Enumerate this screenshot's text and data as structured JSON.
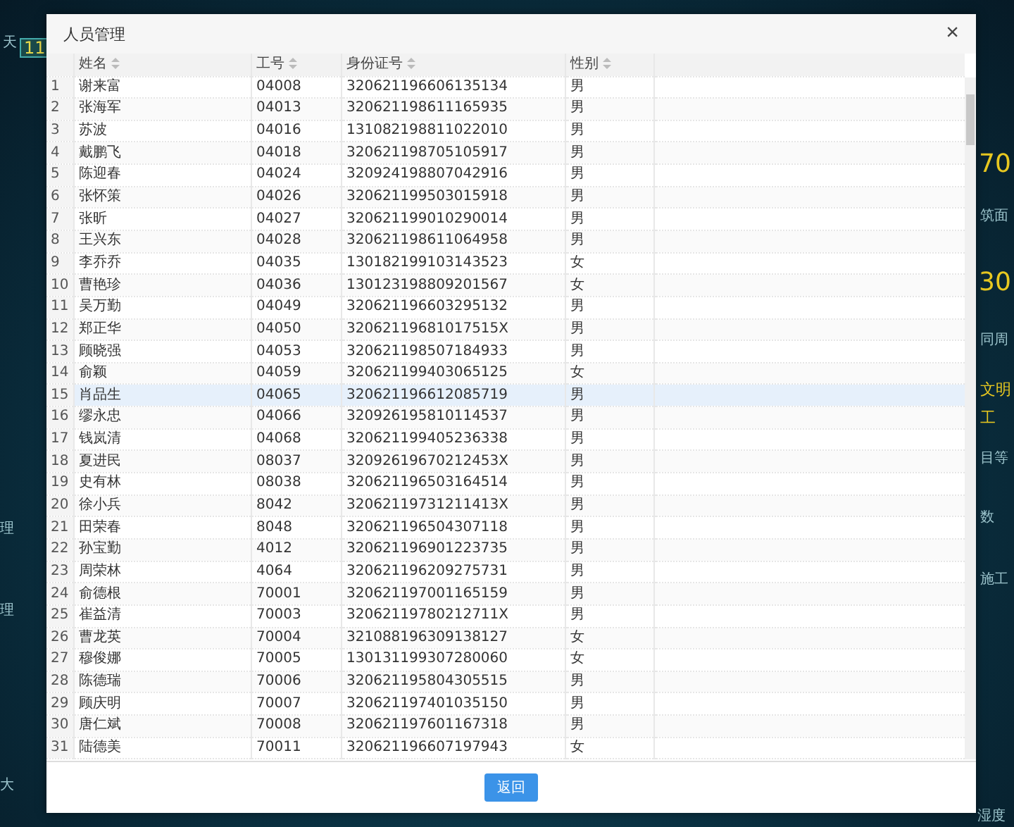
{
  "background": {
    "left_texts": [
      "天",
      "11",
      "理",
      "理",
      "大"
    ],
    "right_texts": [
      "70",
      "筑面",
      "30",
      "同周",
      "文明",
      "工",
      "目等",
      "数",
      "施工",
      "湿度"
    ]
  },
  "dialog": {
    "title": "人员管理",
    "close": "×",
    "table": {
      "columns": [
        {
          "label": "姓名",
          "sortable": true
        },
        {
          "label": "工号",
          "sortable": true
        },
        {
          "label": "身份证号",
          "sortable": true
        },
        {
          "label": "性别",
          "sortable": true
        }
      ],
      "rows": [
        {
          "index": "1",
          "cells": [
            "谢来富",
            "04008",
            "320621196606135134",
            "男"
          ],
          "selected": false
        },
        {
          "index": "2",
          "cells": [
            "张海军",
            "04013",
            "320621198611165935",
            "男"
          ],
          "selected": false
        },
        {
          "index": "3",
          "cells": [
            "苏波",
            "04016",
            "131082198811022010",
            "男"
          ],
          "selected": false
        },
        {
          "index": "4",
          "cells": [
            "戴鹏飞",
            "04018",
            "320621198705105917",
            "男"
          ],
          "selected": false
        },
        {
          "index": "5",
          "cells": [
            "陈迎春",
            "04024",
            "320924198807042916",
            "男"
          ],
          "selected": false
        },
        {
          "index": "6",
          "cells": [
            "张怀策",
            "04026",
            "320621199503015918",
            "男"
          ],
          "selected": false
        },
        {
          "index": "7",
          "cells": [
            "张昕",
            "04027",
            "320621199010290014",
            "男"
          ],
          "selected": false
        },
        {
          "index": "8",
          "cells": [
            "王兴东",
            "04028",
            "320621198611064958",
            "男"
          ],
          "selected": false
        },
        {
          "index": "9",
          "cells": [
            "李乔乔",
            "04035",
            "130182199103143523",
            "女"
          ],
          "selected": false
        },
        {
          "index": "10",
          "cells": [
            "曹艳珍",
            "04036",
            "130123198809201567",
            "女"
          ],
          "selected": false
        },
        {
          "index": "11",
          "cells": [
            "吴万勤",
            "04049",
            "320621196603295132",
            "男"
          ],
          "selected": false
        },
        {
          "index": "12",
          "cells": [
            "郑正华",
            "04050",
            "32062119681017515X",
            "男"
          ],
          "selected": false
        },
        {
          "index": "13",
          "cells": [
            "顾晓强",
            "04053",
            "320621198507184933",
            "男"
          ],
          "selected": false
        },
        {
          "index": "14",
          "cells": [
            "俞颖",
            "04059",
            "320621199403065125",
            "女"
          ],
          "selected": false
        },
        {
          "index": "15",
          "cells": [
            "肖品生",
            "04065",
            "320621196612085719",
            "男"
          ],
          "selected": true
        },
        {
          "index": "16",
          "cells": [
            "缪永忠",
            "04066",
            "320926195810114537",
            "男"
          ],
          "selected": false
        },
        {
          "index": "17",
          "cells": [
            "钱岚清",
            "04068",
            "320621199405236338",
            "男"
          ],
          "selected": false
        },
        {
          "index": "18",
          "cells": [
            "夏进民",
            "08037",
            "32092619670212453X",
            "男"
          ],
          "selected": false
        },
        {
          "index": "19",
          "cells": [
            "史有林",
            "08038",
            "320621196503164514",
            "男"
          ],
          "selected": false
        },
        {
          "index": "20",
          "cells": [
            "徐小兵",
            "8042",
            "32062119731211413X",
            "男"
          ],
          "selected": false
        },
        {
          "index": "21",
          "cells": [
            "田荣春",
            "8048",
            "320621196504307118",
            "男"
          ],
          "selected": false
        },
        {
          "index": "22",
          "cells": [
            "孙宝勤",
            "4012",
            "320621196901223735",
            "男"
          ],
          "selected": false
        },
        {
          "index": "23",
          "cells": [
            "周荣林",
            "4064",
            "320621196209275731",
            "男"
          ],
          "selected": false
        },
        {
          "index": "24",
          "cells": [
            "俞德根",
            "70001",
            "320621197001165159",
            "男"
          ],
          "selected": false
        },
        {
          "index": "25",
          "cells": [
            "崔益清",
            "70003",
            "32062119780212711X",
            "男"
          ],
          "selected": false
        },
        {
          "index": "26",
          "cells": [
            "曹龙英",
            "70004",
            "321088196309138127",
            "女"
          ],
          "selected": false
        },
        {
          "index": "27",
          "cells": [
            "穆俊娜",
            "70005",
            "130131199307280060",
            "女"
          ],
          "selected": false
        },
        {
          "index": "28",
          "cells": [
            "陈德瑞",
            "70006",
            "320621195804305515",
            "男"
          ],
          "selected": false
        },
        {
          "index": "29",
          "cells": [
            "顾庆明",
            "70007",
            "320621197401035150",
            "男"
          ],
          "selected": false
        },
        {
          "index": "30",
          "cells": [
            "唐仁斌",
            "70008",
            "320621197601167318",
            "男"
          ],
          "selected": false
        },
        {
          "index": "31",
          "cells": [
            "陆德美",
            "70011",
            "320621196607197943",
            "女"
          ],
          "selected": false
        }
      ]
    },
    "buttons": [
      {
        "label": "返回"
      }
    ]
  }
}
